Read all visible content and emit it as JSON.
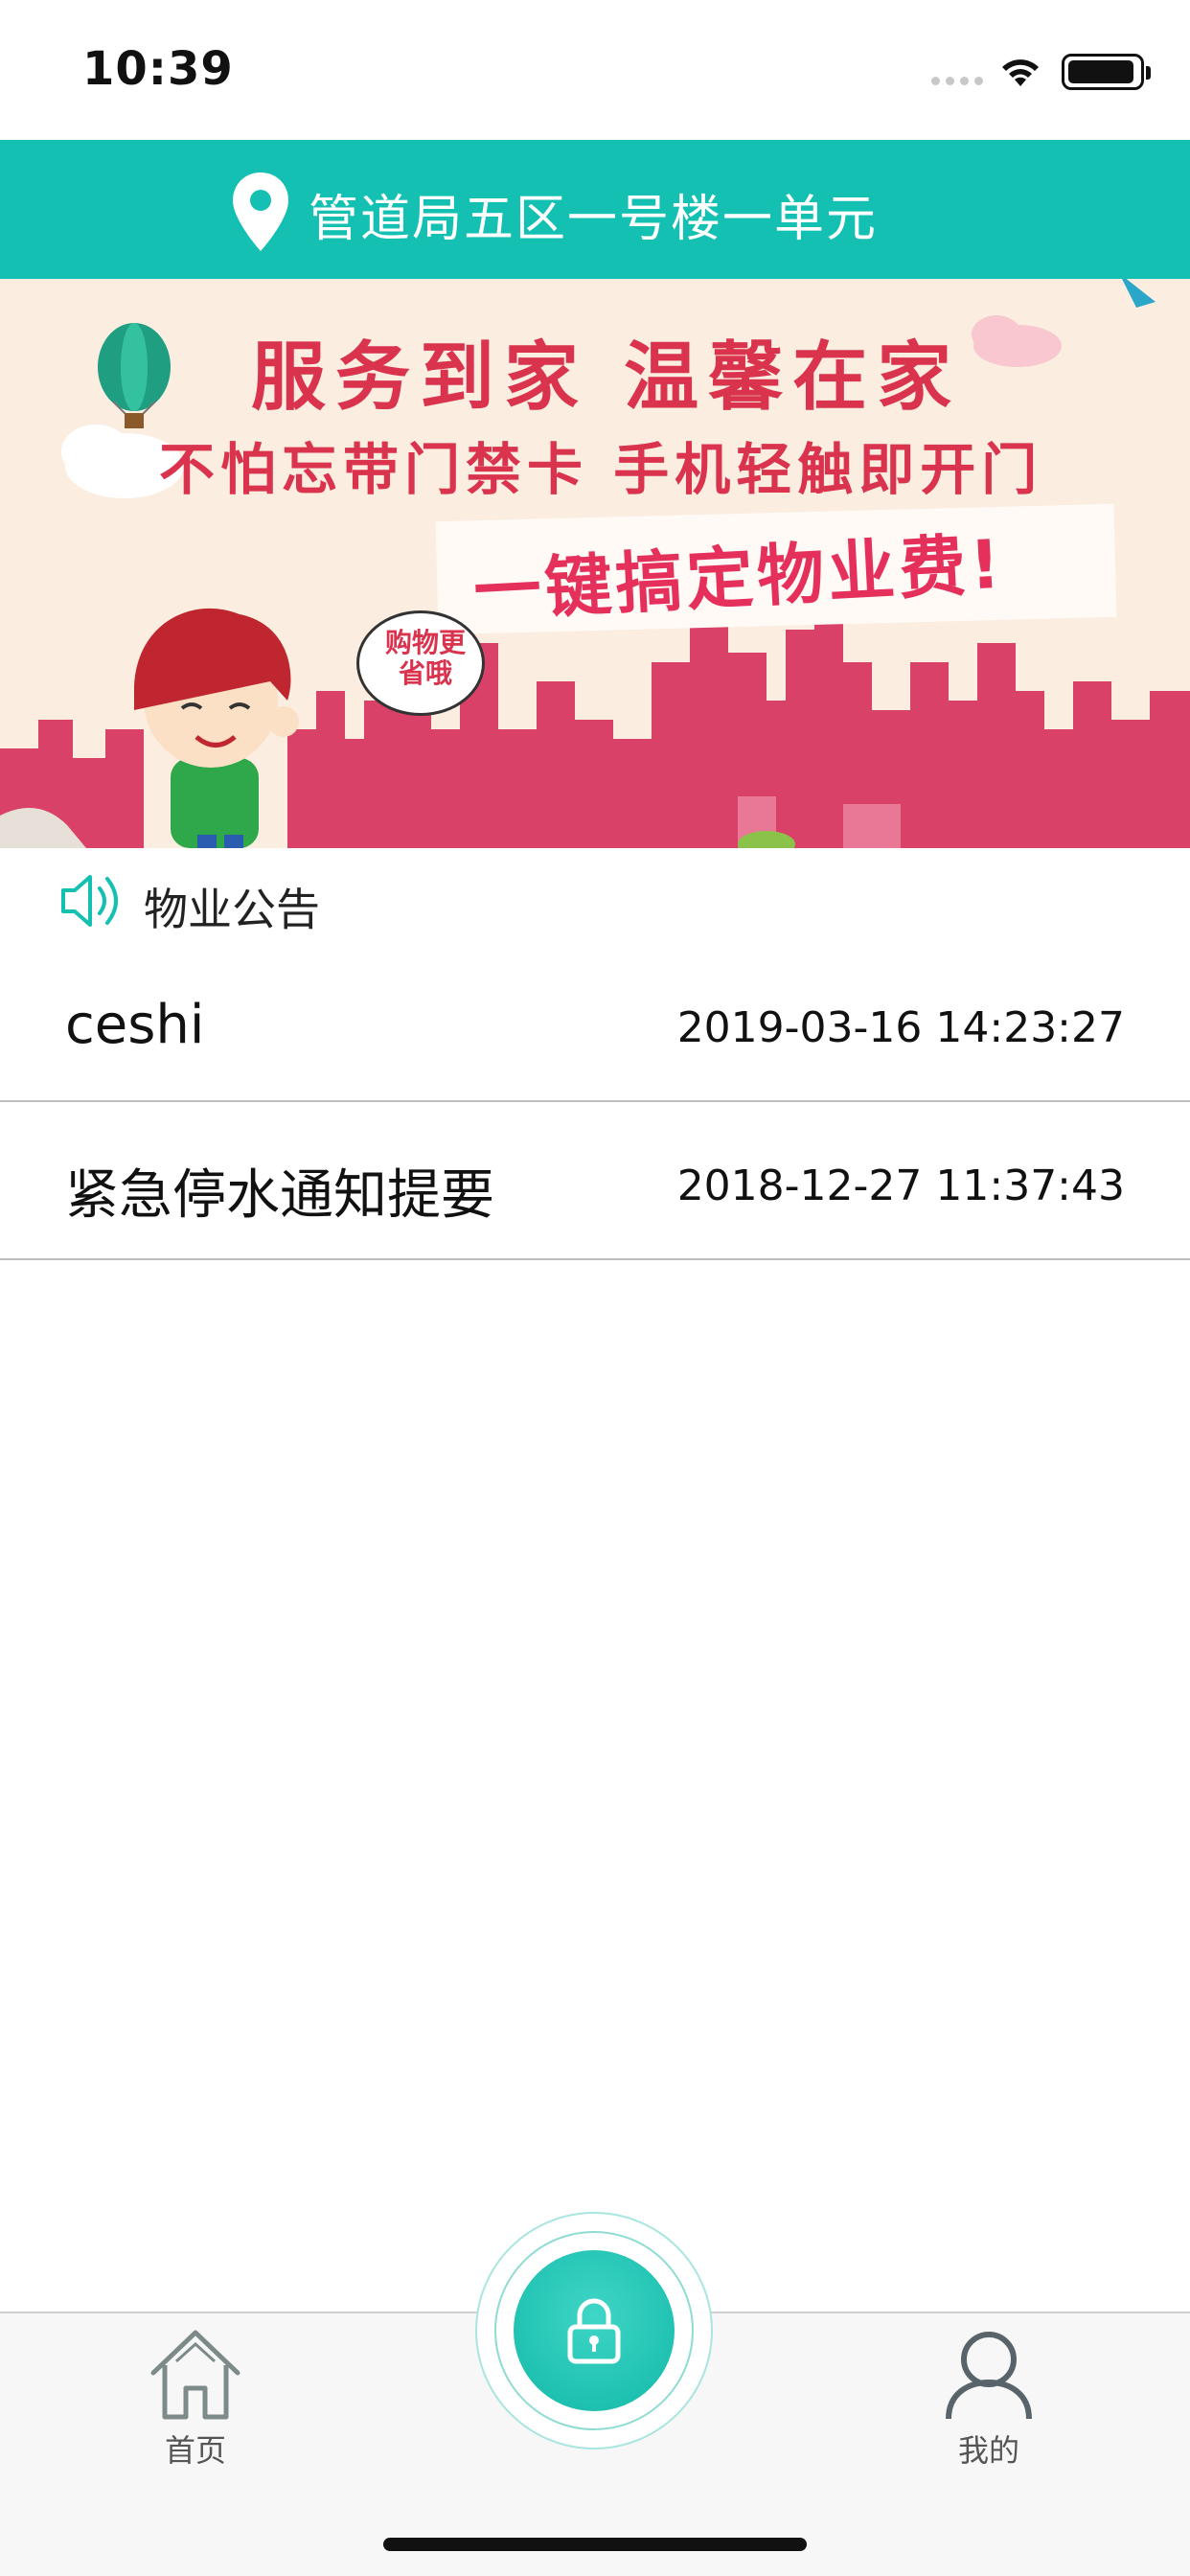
{
  "status_bar": {
    "time": "10:39"
  },
  "header": {
    "location": "管道局五区一号楼一单元",
    "pin_icon": "location-pin-icon"
  },
  "banner": {
    "line1": "服务到家 温馨在家",
    "line2": "不怕忘带门禁卡 手机轻触即开门",
    "line3": "一键搞定物业费!",
    "speech_bubble": "购物更省哦"
  },
  "notices": {
    "section_title": "物业公告",
    "icon": "speaker-icon",
    "items": [
      {
        "title": "ceshi",
        "date": "2019-03-16 14:23:27"
      },
      {
        "title": "紧急停水通知提要",
        "date": "2018-12-27 11:37:43"
      }
    ]
  },
  "tab_bar": {
    "home_label": "首页",
    "mine_label": "我的",
    "center_icon": "lock-icon"
  },
  "colors": {
    "accent": "#13c0b1",
    "banner_red": "#d9334e",
    "banner_bg": "#fbeee1"
  }
}
